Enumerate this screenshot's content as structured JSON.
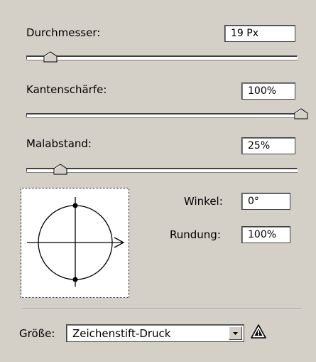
{
  "brush": {
    "diameter": {
      "label": "Durchmesser:",
      "value": "19 Px",
      "slider_level": 0.1
    },
    "hardness": {
      "label": "Kantenschärfe:",
      "value": "100%",
      "slider_level": 1.0
    },
    "spacing": {
      "label": "Malabstand:",
      "value": "25%",
      "slider_level": 0.13
    },
    "angle": {
      "label": "Winkel:",
      "value": "0°"
    },
    "roundness": {
      "label": "Rundung:",
      "value": "100%"
    }
  },
  "size_control": {
    "label": "Größe:",
    "selected": "Zeichenstift-Druck",
    "warning_icon": "warning-triangle-icon"
  },
  "colors": {
    "panel_bg": "#d4d0c8",
    "field_bg": "#ffffff",
    "border_dark": "#404040"
  }
}
